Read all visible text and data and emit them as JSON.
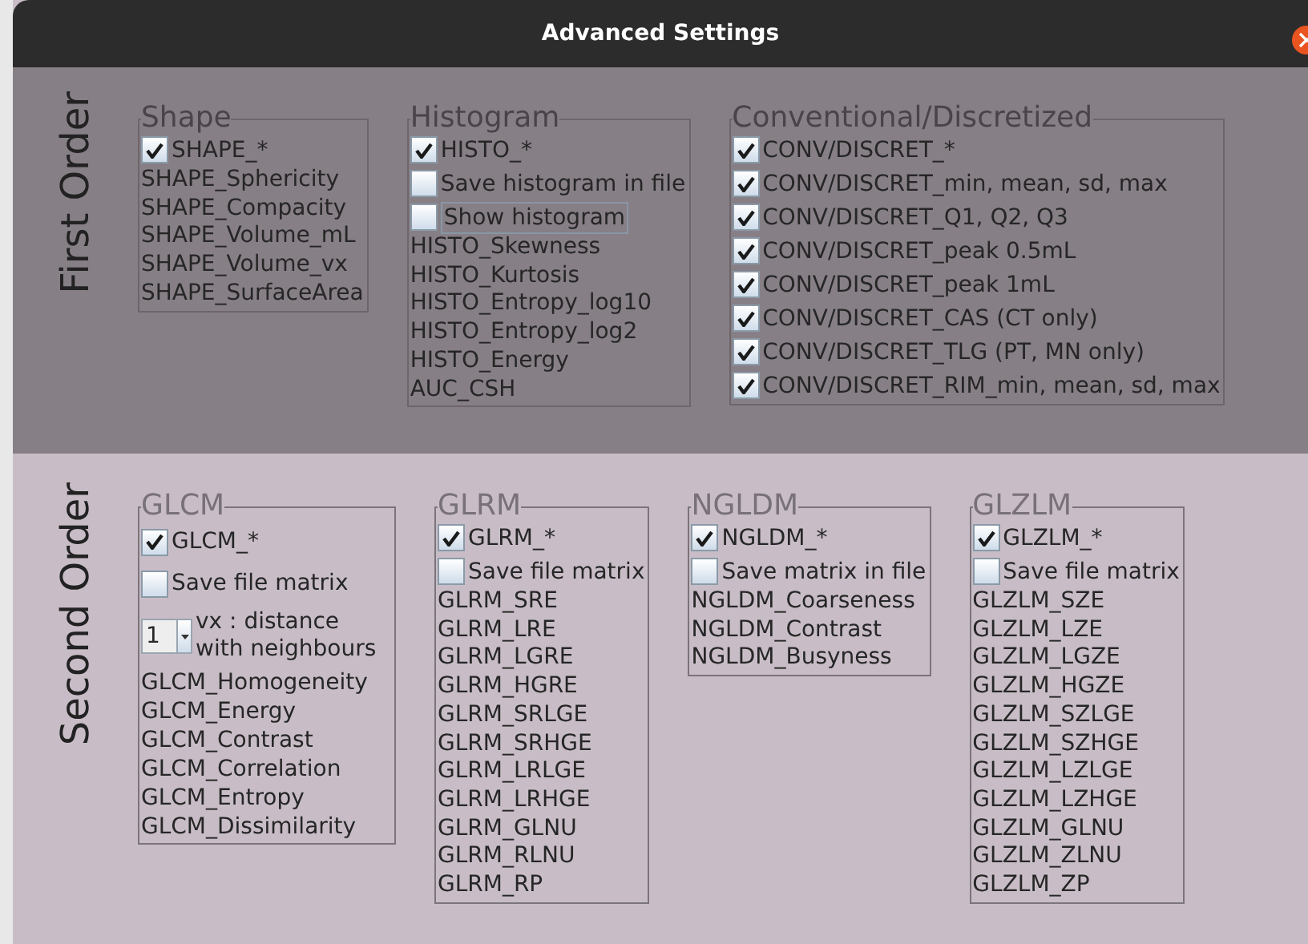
{
  "window": {
    "title": "Advanced Settings"
  },
  "sections": [
    {
      "title": "First Order",
      "groups": [
        {
          "title": "Shape",
          "items": [
            {
              "kind": "checkbox",
              "label": "SHAPE_*",
              "checked": true
            },
            {
              "kind": "label",
              "label": "SHAPE_Sphericity"
            },
            {
              "kind": "label",
              "label": "SHAPE_Compacity"
            },
            {
              "kind": "label",
              "label": "SHAPE_Volume_mL"
            },
            {
              "kind": "label",
              "label": "SHAPE_Volume_vx"
            },
            {
              "kind": "label",
              "label": "SHAPE_SurfaceArea"
            }
          ]
        },
        {
          "title": "Histogram",
          "items": [
            {
              "kind": "checkbox",
              "label": "HISTO_*",
              "checked": true
            },
            {
              "kind": "checkbox",
              "label": "Save histogram in file",
              "checked": false
            },
            {
              "kind": "checkbox",
              "label": "Show histogram",
              "checked": false,
              "focused": true
            },
            {
              "kind": "label",
              "label": "HISTO_Skewness"
            },
            {
              "kind": "label",
              "label": "HISTO_Kurtosis"
            },
            {
              "kind": "label",
              "label": "HISTO_Entropy_log10"
            },
            {
              "kind": "label",
              "label": "HISTO_Entropy_log2"
            },
            {
              "kind": "label",
              "label": "HISTO_Energy"
            },
            {
              "kind": "label",
              "label": "AUC_CSH"
            }
          ]
        },
        {
          "title": "Conventional/Discretized",
          "items": [
            {
              "kind": "checkbox",
              "label": "CONV/DISCRET_*",
              "checked": true
            },
            {
              "kind": "checkbox",
              "label": "CONV/DISCRET_min, mean, sd, max",
              "checked": true
            },
            {
              "kind": "checkbox",
              "label": "CONV/DISCRET_Q1, Q2, Q3",
              "checked": true
            },
            {
              "kind": "checkbox",
              "label": "CONV/DISCRET_peak 0.5mL",
              "checked": true
            },
            {
              "kind": "checkbox",
              "label": "CONV/DISCRET_peak 1mL",
              "checked": true
            },
            {
              "kind": "checkbox",
              "label": "CONV/DISCRET_CAS (CT only)",
              "checked": true
            },
            {
              "kind": "checkbox",
              "label": "CONV/DISCRET_TLG (PT, MN only)",
              "checked": true
            },
            {
              "kind": "checkbox",
              "label": "CONV/DISCRET_RIM_min, mean, sd, max",
              "checked": true
            }
          ]
        }
      ]
    },
    {
      "title": "Second Order",
      "groups": [
        {
          "title": "GLCM",
          "items": [
            {
              "kind": "checkbox",
              "label": "GLCM_*",
              "checked": true
            },
            {
              "kind": "checkbox",
              "label": "Save file matrix",
              "checked": false
            },
            {
              "kind": "combo",
              "value": "1",
              "label": "vx : distance with neighbours"
            },
            {
              "kind": "label",
              "label": "GLCM_Homogeneity"
            },
            {
              "kind": "label",
              "label": "GLCM_Energy"
            },
            {
              "kind": "label",
              "label": "GLCM_Contrast"
            },
            {
              "kind": "label",
              "label": "GLCM_Correlation"
            },
            {
              "kind": "label",
              "label": "GLCM_Entropy"
            },
            {
              "kind": "label",
              "label": "GLCM_Dissimilarity"
            }
          ]
        },
        {
          "title": "GLRM",
          "items": [
            {
              "kind": "checkbox",
              "label": "GLRM_*",
              "checked": true
            },
            {
              "kind": "checkbox",
              "label": "Save file matrix",
              "checked": false
            },
            {
              "kind": "label",
              "label": "GLRM_SRE"
            },
            {
              "kind": "label",
              "label": "GLRM_LRE"
            },
            {
              "kind": "label",
              "label": "GLRM_LGRE"
            },
            {
              "kind": "label",
              "label": "GLRM_HGRE"
            },
            {
              "kind": "label",
              "label": "GLRM_SRLGE"
            },
            {
              "kind": "label",
              "label": "GLRM_SRHGE"
            },
            {
              "kind": "label",
              "label": "GLRM_LRLGE"
            },
            {
              "kind": "label",
              "label": "GLRM_LRHGE"
            },
            {
              "kind": "label",
              "label": "GLRM_GLNU"
            },
            {
              "kind": "label",
              "label": "GLRM_RLNU"
            },
            {
              "kind": "label",
              "label": "GLRM_RP"
            }
          ]
        },
        {
          "title": "NGLDM",
          "items": [
            {
              "kind": "checkbox",
              "label": "NGLDM_*",
              "checked": true
            },
            {
              "kind": "checkbox",
              "label": "Save matrix in file",
              "checked": false
            },
            {
              "kind": "label",
              "label": "NGLDM_Coarseness"
            },
            {
              "kind": "label",
              "label": "NGLDM_Contrast"
            },
            {
              "kind": "label",
              "label": "NGLDM_Busyness"
            }
          ]
        },
        {
          "title": "GLZLM",
          "items": [
            {
              "kind": "checkbox",
              "label": "GLZLM_*",
              "checked": true
            },
            {
              "kind": "checkbox",
              "label": "Save file matrix",
              "checked": false
            },
            {
              "kind": "label",
              "label": "GLZLM_SZE"
            },
            {
              "kind": "label",
              "label": "GLZLM_LZE"
            },
            {
              "kind": "label",
              "label": "GLZLM_LGZE"
            },
            {
              "kind": "label",
              "label": "GLZLM_HGZE"
            },
            {
              "kind": "label",
              "label": "GLZLM_SZLGE"
            },
            {
              "kind": "label",
              "label": "GLZLM_SZHGE"
            },
            {
              "kind": "label",
              "label": "GLZLM_LZLGE"
            },
            {
              "kind": "label",
              "label": "GLZLM_LZHGE"
            },
            {
              "kind": "label",
              "label": "GLZLM_GLNU"
            },
            {
              "kind": "label",
              "label": "GLZLM_ZLNU"
            },
            {
              "kind": "label",
              "label": "GLZLM_ZP"
            }
          ]
        }
      ]
    }
  ]
}
